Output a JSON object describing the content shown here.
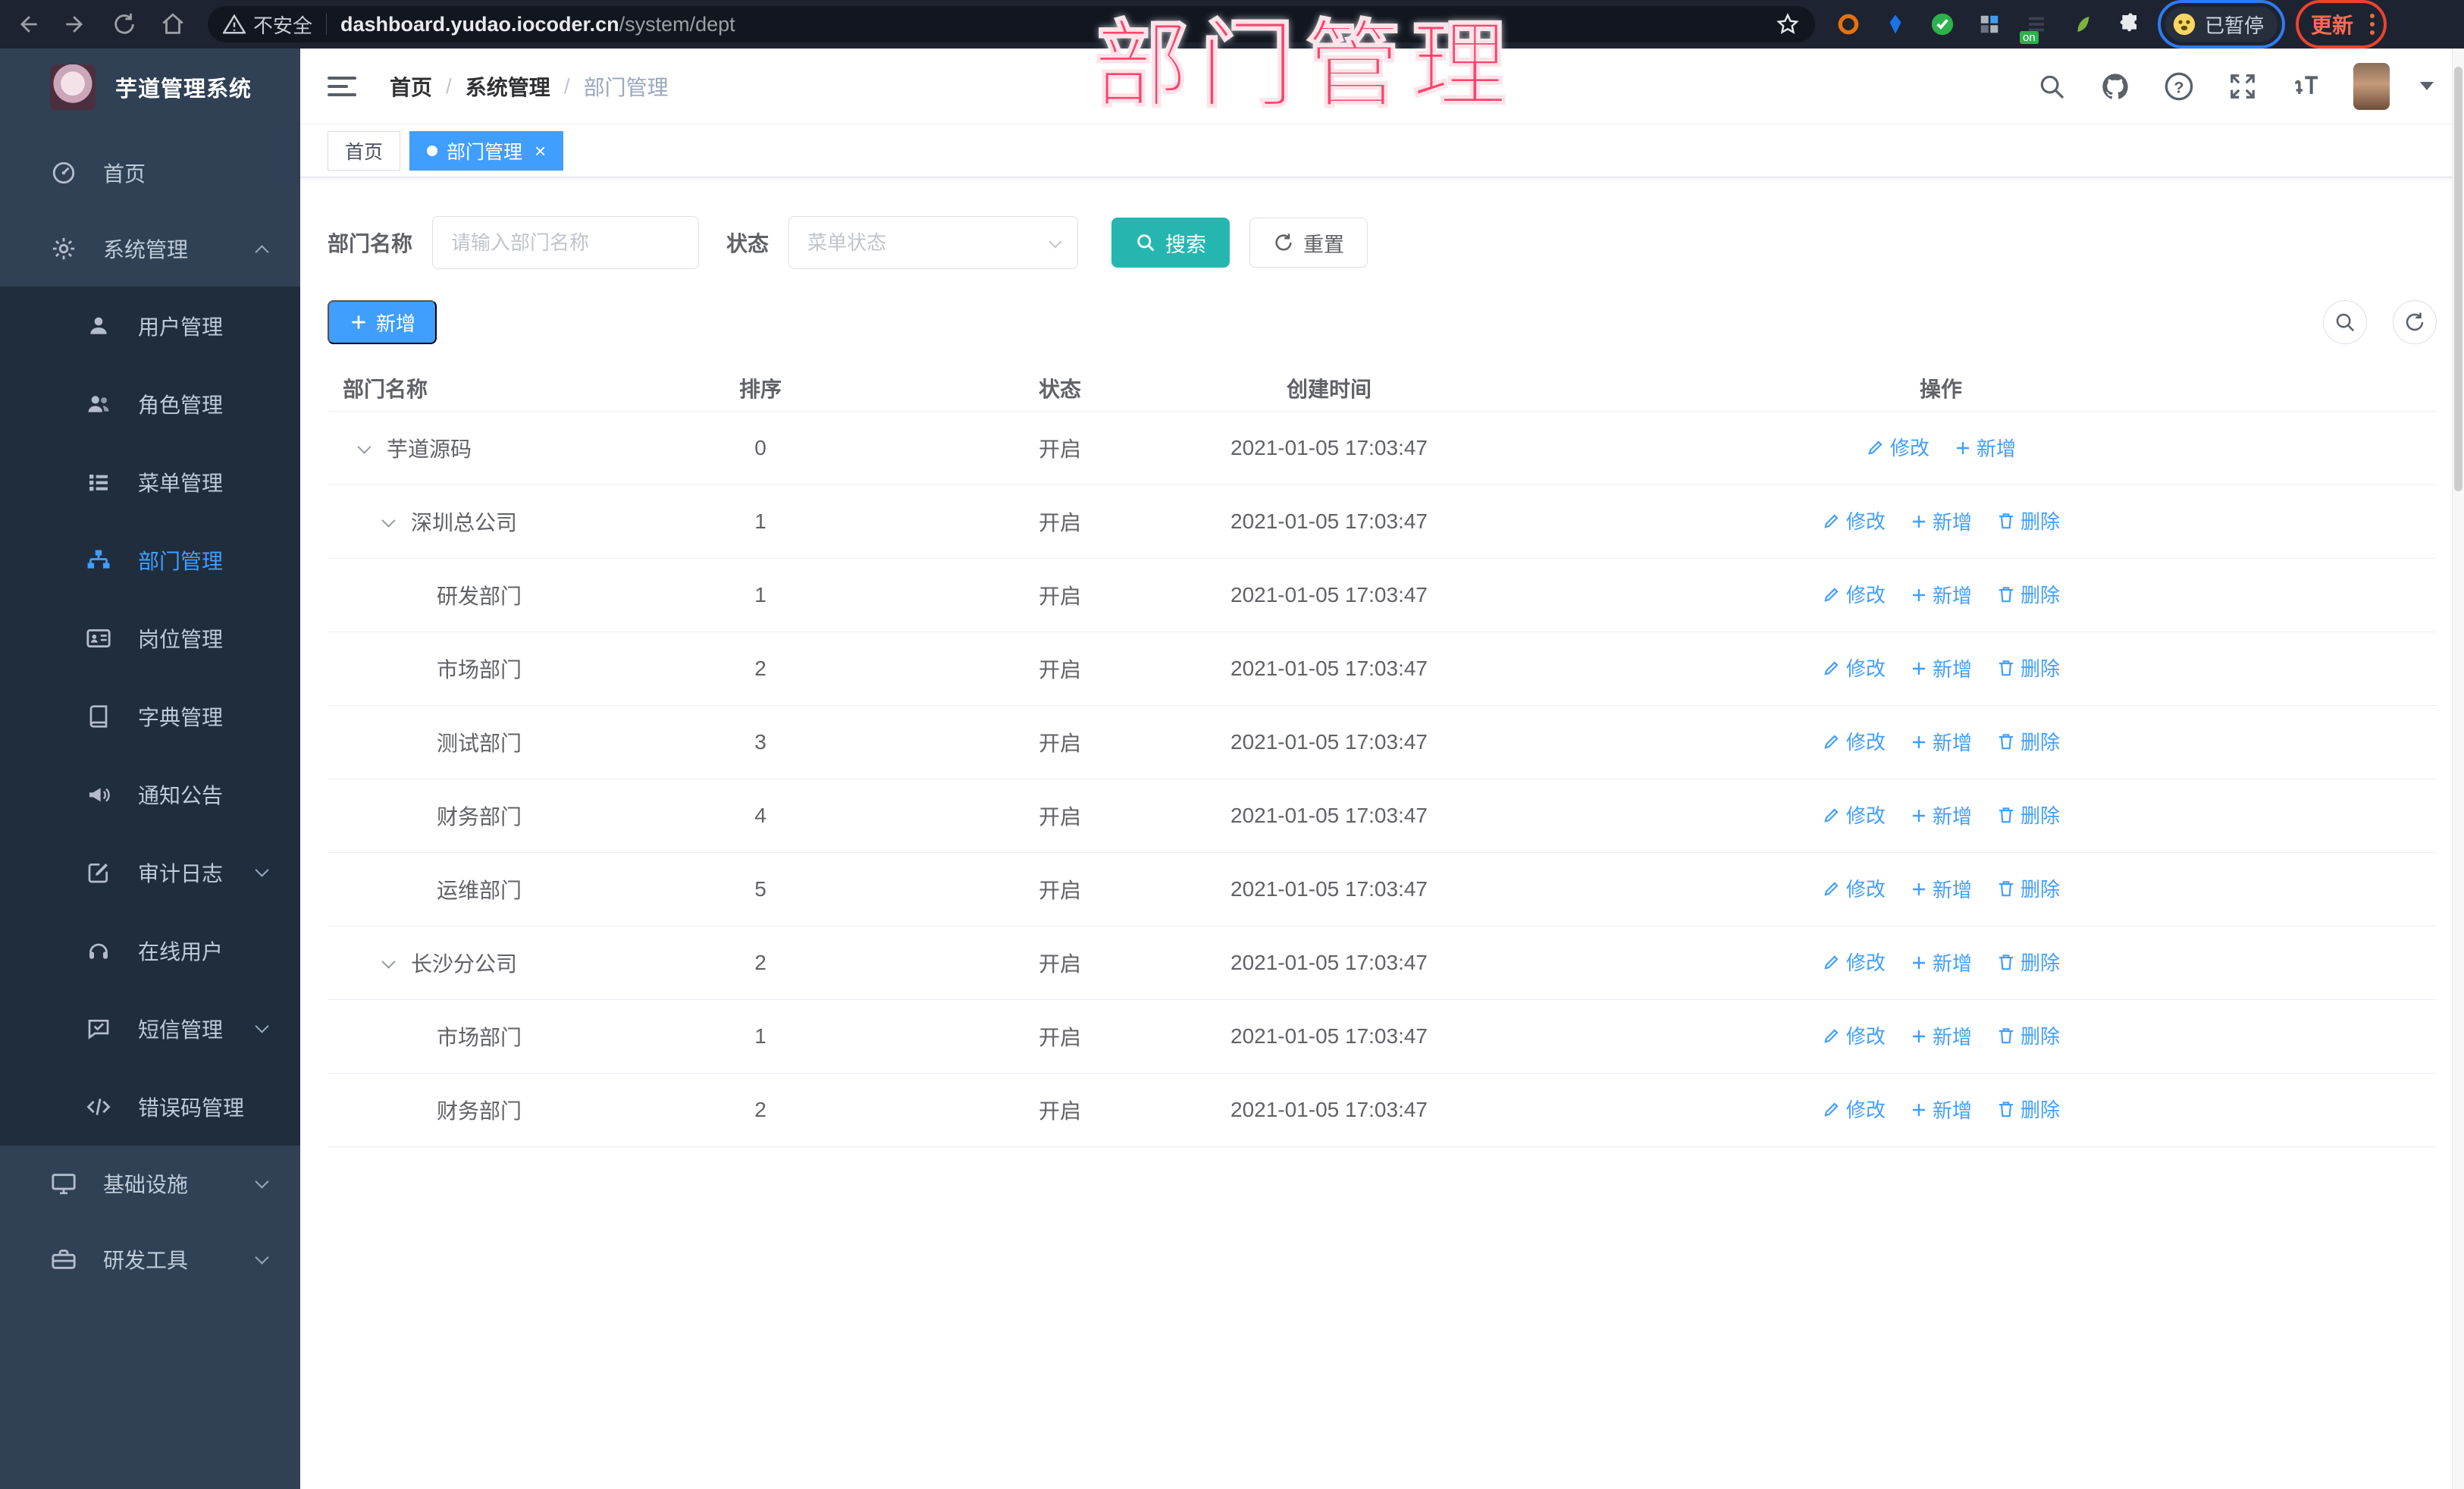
{
  "browser": {
    "security_label": "不安全",
    "url_host": "dashboard.yudao.iocoder.cn",
    "url_path": "/system/dept",
    "paused_label": "已暂停",
    "update_label": "更新"
  },
  "annotation": {
    "text": "部门管理",
    "color": "#f8466e"
  },
  "sidebar": {
    "app_title": "芋道管理系统",
    "items": [
      {
        "id": "home",
        "label": "首页",
        "icon": "home-icon",
        "level": 0
      },
      {
        "id": "system-mgmt",
        "label": "系统管理",
        "icon": "gear-icon",
        "level": 0,
        "chevron": "up"
      },
      {
        "id": "user-mgmt",
        "label": "用户管理",
        "icon": "user-icon",
        "level": 1
      },
      {
        "id": "role-mgmt",
        "label": "角色管理",
        "icon": "users-icon",
        "level": 1
      },
      {
        "id": "menu-mgmt",
        "label": "菜单管理",
        "icon": "menu-list-icon",
        "level": 1
      },
      {
        "id": "dept-mgmt",
        "label": "部门管理",
        "icon": "org-tree-icon",
        "level": 1,
        "active": true
      },
      {
        "id": "post-mgmt",
        "label": "岗位管理",
        "icon": "id-card-icon",
        "level": 1
      },
      {
        "id": "dict-mgmt",
        "label": "字典管理",
        "icon": "book-icon",
        "level": 1
      },
      {
        "id": "notice",
        "label": "通知公告",
        "icon": "megaphone-icon",
        "level": 1
      },
      {
        "id": "audit-log",
        "label": "审计日志",
        "icon": "audit-icon",
        "level": 1,
        "chevron": "down"
      },
      {
        "id": "online-users",
        "label": "在线用户",
        "icon": "headset-icon",
        "level": 1
      },
      {
        "id": "sms-mgmt",
        "label": "短信管理",
        "icon": "sms-icon",
        "level": 1,
        "chevron": "down"
      },
      {
        "id": "error-code-mgmt",
        "label": "错误码管理",
        "icon": "code-icon",
        "level": 1
      },
      {
        "id": "infrastructure",
        "label": "基础设施",
        "icon": "monitor-icon",
        "level": 0,
        "chevron": "down"
      },
      {
        "id": "dev-tools",
        "label": "研发工具",
        "icon": "toolbox-icon",
        "level": 0,
        "chevron": "down"
      }
    ]
  },
  "header": {
    "breadcrumb": [
      "首页",
      "系统管理",
      "部门管理"
    ]
  },
  "tabs": [
    {
      "label": "首页",
      "active": false
    },
    {
      "label": "部门管理",
      "active": true,
      "closable": true
    }
  ],
  "filters": {
    "dept_label": "部门名称",
    "dept_placeholder": "请输入部门名称",
    "dept_value": "",
    "status_label": "状态",
    "status_placeholder": "菜单状态",
    "status_value": "",
    "search_label": "搜索",
    "reset_label": "重置"
  },
  "toolbar": {
    "add_label": "新增"
  },
  "table": {
    "columns": [
      "部门名称",
      "排序",
      "状态",
      "创建时间",
      "操作"
    ],
    "action_labels": {
      "edit": "修改",
      "add": "新增",
      "delete": "删除"
    },
    "rows": [
      {
        "name": "芋道源码",
        "level": 0,
        "expandable": true,
        "order": "0",
        "status": "开启",
        "created": "2021-01-05 17:03:47",
        "actions": [
          "edit",
          "add"
        ]
      },
      {
        "name": "深圳总公司",
        "level": 1,
        "expandable": true,
        "order": "1",
        "status": "开启",
        "created": "2021-01-05 17:03:47",
        "actions": [
          "edit",
          "add",
          "delete"
        ]
      },
      {
        "name": "研发部门",
        "level": 2,
        "expandable": false,
        "order": "1",
        "status": "开启",
        "created": "2021-01-05 17:03:47",
        "actions": [
          "edit",
          "add",
          "delete"
        ]
      },
      {
        "name": "市场部门",
        "level": 2,
        "expandable": false,
        "order": "2",
        "status": "开启",
        "created": "2021-01-05 17:03:47",
        "actions": [
          "edit",
          "add",
          "delete"
        ]
      },
      {
        "name": "测试部门",
        "level": 2,
        "expandable": false,
        "order": "3",
        "status": "开启",
        "created": "2021-01-05 17:03:47",
        "actions": [
          "edit",
          "add",
          "delete"
        ]
      },
      {
        "name": "财务部门",
        "level": 2,
        "expandable": false,
        "order": "4",
        "status": "开启",
        "created": "2021-01-05 17:03:47",
        "actions": [
          "edit",
          "add",
          "delete"
        ]
      },
      {
        "name": "运维部门",
        "level": 2,
        "expandable": false,
        "order": "5",
        "status": "开启",
        "created": "2021-01-05 17:03:47",
        "actions": [
          "edit",
          "add",
          "delete"
        ]
      },
      {
        "name": "长沙分公司",
        "level": 1,
        "expandable": true,
        "order": "2",
        "status": "开启",
        "created": "2021-01-05 17:03:47",
        "actions": [
          "edit",
          "add",
          "delete"
        ]
      },
      {
        "name": "市场部门",
        "level": 2,
        "expandable": false,
        "order": "1",
        "status": "开启",
        "created": "2021-01-05 17:03:47",
        "actions": [
          "edit",
          "add",
          "delete"
        ]
      },
      {
        "name": "财务部门",
        "level": 2,
        "expandable": false,
        "order": "2",
        "status": "开启",
        "created": "2021-01-05 17:03:47",
        "actions": [
          "edit",
          "add",
          "delete"
        ]
      }
    ]
  },
  "colors": {
    "accent_blue": "#409eff",
    "search_teal": "#26b6b0",
    "annotation_pink": "#f8466e",
    "sidebar_bg": "#304156",
    "sidebar_submenu_bg": "#1f2d3d",
    "chrome_bg": "#1d2330"
  }
}
